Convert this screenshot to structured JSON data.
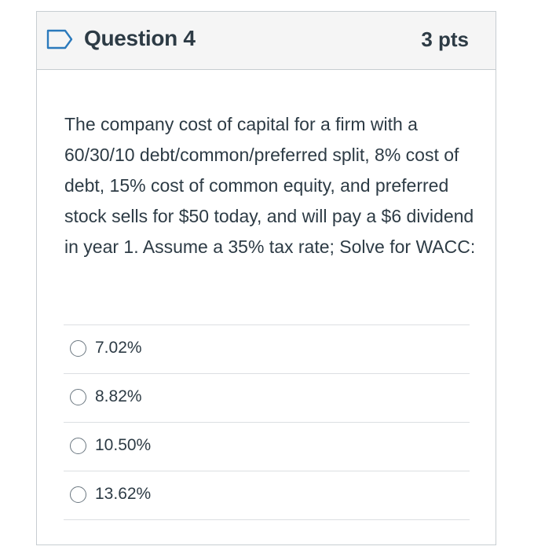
{
  "question": {
    "title": "Question 4",
    "points": "3 pts",
    "icon": "flag-outline-icon",
    "text": "The company cost of capital for a firm with a 60/30/10 debt/common/preferred split, 8% cost of debt, 15% cost of common equity, and preferred stock sells for $50 today, and will pay a $6 dividend in year 1. Assume a 35% tax rate; Solve for WACC:",
    "answers": [
      {
        "label": "7.02%"
      },
      {
        "label": "8.82%"
      },
      {
        "label": "10.50%"
      },
      {
        "label": "13.62%"
      }
    ]
  },
  "colors": {
    "header_bg": "#f5f5f5",
    "border": "#c7cdd1",
    "text": "#2d3b45",
    "flag_stroke": "#2b7abc"
  }
}
